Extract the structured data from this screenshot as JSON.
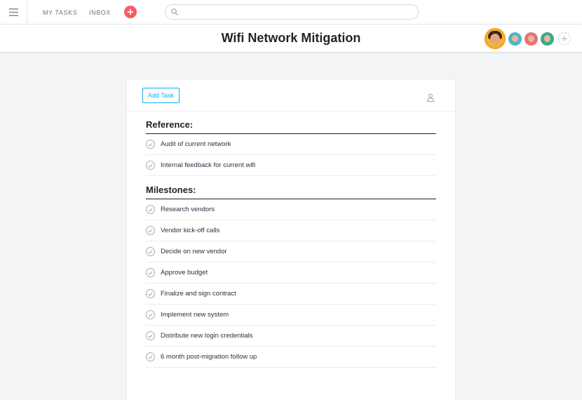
{
  "topbar": {
    "menu_icon": "hamburger-icon",
    "nav": [
      {
        "label": "MY TASKS"
      },
      {
        "label": "INBOX"
      }
    ],
    "quick_add_icon": "plus-icon",
    "search": {
      "value": "",
      "placeholder": "",
      "icon": "search-icon"
    }
  },
  "header": {
    "title": "Wifi Network Mitigation",
    "members": [
      {
        "icon": "avatar",
        "color": "#f2b33c"
      },
      {
        "icon": "avatar",
        "color": "#4ab6c9"
      },
      {
        "icon": "avatar",
        "color": "#e9707c"
      },
      {
        "icon": "avatar",
        "color": "#3aa98c"
      }
    ],
    "add_member_icon": "plus-icon"
  },
  "card": {
    "add_task_label": "Add Task",
    "assignee_icon": "person-icon",
    "sections": [
      {
        "name": "Reference:",
        "tasks": [
          {
            "name": "Audit of current network"
          },
          {
            "name": "Internal feedback for current wifi"
          }
        ]
      },
      {
        "name": "Milestones:",
        "tasks": [
          {
            "name": "Research vendors"
          },
          {
            "name": "Vendor kick-off calls"
          },
          {
            "name": "Decide on new vendor"
          },
          {
            "name": "Approve budget"
          },
          {
            "name": "Finalize and sign contract"
          },
          {
            "name": "Implement new system"
          },
          {
            "name": "Distribute new login credentials"
          },
          {
            "name": "6 month post-migration follow up"
          }
        ]
      }
    ]
  },
  "colors": {
    "accent": "#14aaf5",
    "quick_add": "#f25a56",
    "background": "#f3f4f5"
  }
}
